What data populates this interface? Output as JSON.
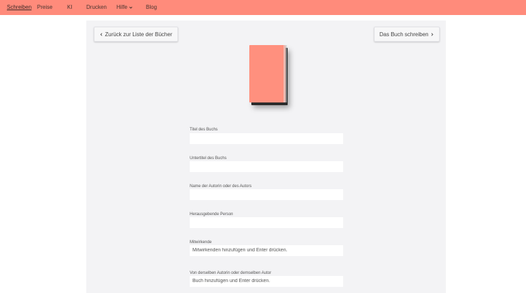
{
  "nav": {
    "items": [
      {
        "label": "Schreiben",
        "active": true
      },
      {
        "label": "Preise"
      },
      {
        "label": "KI"
      },
      {
        "label": "Drucken"
      },
      {
        "label": "Hilfe",
        "icon": "chevron-down-icon"
      },
      {
        "label": "Blog"
      }
    ],
    "bg_color": "#ff8b7b"
  },
  "header": {
    "back_label": "Zurück zur Liste der Bücher",
    "next_label": "Das Buch schreiben"
  },
  "book": {
    "cover_color": "#ff907e"
  },
  "form": {
    "title_label": "Titel des Buchs",
    "subtitle_label": "Untertitel des Buchs",
    "author_label": "Name der Autorin oder des Autors",
    "publisher_label": "Herausgebende Person",
    "contributors_label": "Mitwirkende",
    "contributors_placeholder": "Mitwirkenden hinzufügen und Enter drücken.",
    "same_author_label": "Von derselben Autorin oder demselben Autor",
    "same_author_placeholder": "Buch hinzufügen und Enter drücken."
  }
}
